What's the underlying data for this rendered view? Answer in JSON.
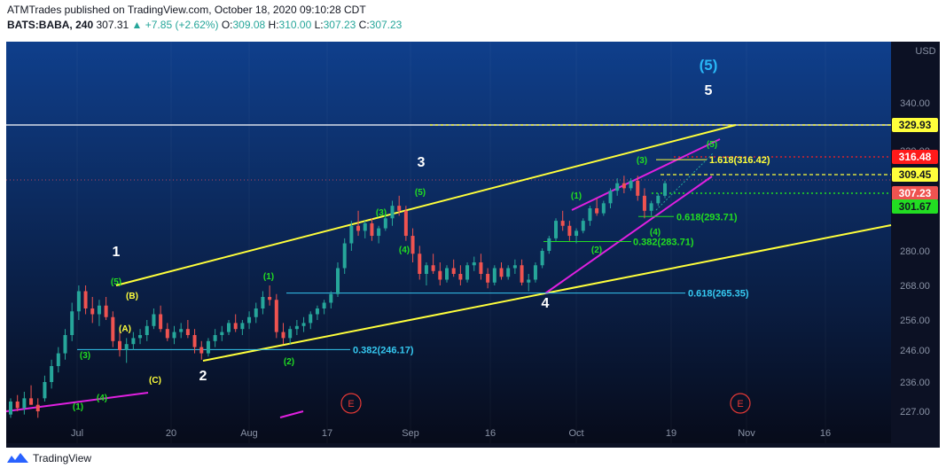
{
  "header": {
    "line1": "ATMTrades published on TradingView.com, October 18, 2020 09:10:28 CDT",
    "symbol": "BATS:BABA, 240",
    "last": "307.31",
    "change_arrow": "▲",
    "change": "+7.85 (+2.62%)",
    "o_label": "O:",
    "o_value": "309.08",
    "h_label": "H:",
    "h_value": "310.00",
    "l_label": "L:",
    "l_value": "307.23",
    "c_label": "C:",
    "c_value": "307.23"
  },
  "footer": {
    "brand": "TradingView"
  },
  "colors": {
    "bg_top": "#0f3f8c",
    "bg_bottom": "#070b1a",
    "up": "#26a69a",
    "down": "#ef5350",
    "channel": "#ffff3b",
    "magenta": "#e020e0",
    "fib_cyan": "#35c8f0",
    "green": "#22dd22",
    "white": "#ffffff"
  },
  "chart_data": {
    "type": "candlestick",
    "currency": "USD",
    "x_ticks": [
      "Jul",
      "20",
      "Aug",
      "17",
      "Sep",
      "16",
      "Oct",
      "19",
      "Nov",
      "16"
    ],
    "y_ticks": [
      227.0,
      236.0,
      246.0,
      256.0,
      268.0,
      280.0,
      320.0,
      340.0
    ],
    "ylim": [
      224,
      362
    ],
    "price_badges": [
      {
        "value": "329.93",
        "bg": "#ffff3b",
        "fg": "#131722"
      },
      {
        "value": "316.48",
        "bg": "#ff1a1a",
        "fg": "#ffffff"
      },
      {
        "value": "309.45",
        "bg": "#ffff3b",
        "fg": "#131722"
      },
      {
        "value": "307.23",
        "bg": "#ef5350",
        "fg": "#ffffff"
      },
      {
        "value": "301.67",
        "bg": "#22dd22",
        "fg": "#131722"
      }
    ],
    "fib_levels": [
      {
        "text": "0.382(246.17)",
        "price": 246.17,
        "color": "#35c8f0"
      },
      {
        "text": "0.618(265.35)",
        "price": 265.35,
        "color": "#35c8f0"
      },
      {
        "text": "0.382(283.71)",
        "price": 283.71,
        "color": "#22dd22"
      },
      {
        "text": "0.618(293.71)",
        "price": 293.71,
        "color": "#22dd22"
      },
      {
        "text": "1.618(316.42)",
        "price": 316.42,
        "color": "#ffff3b"
      }
    ],
    "wave_labels_primary": [
      "1",
      "2",
      "3",
      "4",
      "5",
      "(5)"
    ],
    "wave_labels_minor_green": [
      "(1)",
      "(2)",
      "(3)",
      "(4)",
      "(5)"
    ],
    "wave_labels_abc": [
      "(A)",
      "(B)",
      "(C)"
    ],
    "event_markers": [
      "E",
      "E"
    ],
    "candles": [
      [
        226,
        231,
        225,
        230
      ],
      [
        230,
        232,
        227,
        228
      ],
      [
        228,
        233,
        226,
        231
      ],
      [
        231,
        235,
        229,
        229
      ],
      [
        229,
        231,
        225,
        227
      ],
      [
        231,
        238,
        230,
        236
      ],
      [
        236,
        243,
        234,
        241
      ],
      [
        241,
        247,
        239,
        245
      ],
      [
        245,
        253,
        243,
        251
      ],
      [
        251,
        262,
        249,
        259
      ],
      [
        259,
        268,
        256,
        266
      ],
      [
        266,
        268,
        258,
        260
      ],
      [
        260,
        264,
        255,
        258
      ],
      [
        258,
        263,
        254,
        261
      ],
      [
        261,
        264,
        256,
        257
      ],
      [
        257,
        259,
        247,
        249
      ],
      [
        249,
        253,
        244,
        246
      ],
      [
        246,
        250,
        242,
        248
      ],
      [
        248,
        252,
        246,
        250
      ],
      [
        250,
        253,
        248,
        251
      ],
      [
        251,
        256,
        249,
        254
      ],
      [
        254,
        260,
        253,
        258
      ],
      [
        258,
        261,
        252,
        253
      ],
      [
        253,
        255,
        249,
        250
      ],
      [
        250,
        254,
        248,
        252
      ],
      [
        252,
        255,
        250,
        253
      ],
      [
        253,
        256,
        250,
        251
      ],
      [
        251,
        253,
        245,
        247
      ],
      [
        247,
        249,
        243,
        245
      ],
      [
        245,
        250,
        244,
        249
      ],
      [
        249,
        253,
        247,
        251
      ],
      [
        251,
        254,
        249,
        252
      ],
      [
        252,
        256,
        251,
        255
      ],
      [
        255,
        258,
        252,
        253
      ],
      [
        253,
        256,
        251,
        255
      ],
      [
        255,
        259,
        253,
        257
      ],
      [
        257,
        262,
        255,
        260
      ],
      [
        260,
        266,
        258,
        264
      ],
      [
        264,
        268,
        261,
        263
      ],
      [
        263,
        265,
        250,
        252
      ],
      [
        252,
        255,
        248,
        250
      ],
      [
        250,
        254,
        248,
        253
      ],
      [
        253,
        256,
        251,
        254
      ],
      [
        254,
        257,
        252,
        255
      ],
      [
        255,
        259,
        253,
        258
      ],
      [
        258,
        261,
        256,
        260
      ],
      [
        260,
        263,
        258,
        262
      ],
      [
        262,
        266,
        260,
        265
      ],
      [
        265,
        276,
        264,
        274
      ],
      [
        274,
        285,
        272,
        283
      ],
      [
        283,
        292,
        280,
        290
      ],
      [
        290,
        296,
        286,
        288
      ],
      [
        288,
        292,
        285,
        291
      ],
      [
        291,
        293,
        284,
        286
      ],
      [
        286,
        290,
        283,
        289
      ],
      [
        289,
        295,
        288,
        293
      ],
      [
        293,
        300,
        290,
        298
      ],
      [
        298,
        302,
        294,
        296
      ],
      [
        296,
        298,
        284,
        286
      ],
      [
        286,
        289,
        276,
        279
      ],
      [
        279,
        282,
        270,
        272
      ],
      [
        272,
        276,
        268,
        275
      ],
      [
        275,
        279,
        272,
        273
      ],
      [
        273,
        276,
        268,
        270
      ],
      [
        270,
        275,
        269,
        274
      ],
      [
        274,
        277,
        271,
        272
      ],
      [
        272,
        275,
        268,
        270
      ],
      [
        270,
        276,
        269,
        275
      ],
      [
        275,
        278,
        273,
        276
      ],
      [
        276,
        279,
        270,
        272
      ],
      [
        272,
        274,
        267,
        269
      ],
      [
        269,
        275,
        268,
        274
      ],
      [
        274,
        276,
        270,
        271
      ],
      [
        271,
        275,
        270,
        274
      ],
      [
        274,
        277,
        272,
        275
      ],
      [
        275,
        277,
        268,
        269
      ],
      [
        269,
        272,
        266,
        270
      ],
      [
        270,
        276,
        269,
        275
      ],
      [
        275,
        281,
        274,
        280
      ],
      [
        280,
        286,
        279,
        285
      ],
      [
        285,
        293,
        284,
        292
      ],
      [
        292,
        296,
        288,
        290
      ],
      [
        290,
        292,
        284,
        286
      ],
      [
        286,
        289,
        283,
        288
      ],
      [
        288,
        293,
        287,
        292
      ],
      [
        292,
        298,
        290,
        297
      ],
      [
        297,
        301,
        294,
        295
      ],
      [
        295,
        300,
        294,
        299
      ],
      [
        299,
        305,
        297,
        304
      ],
      [
        304,
        309,
        302,
        307
      ],
      [
        307,
        310,
        303,
        305
      ],
      [
        305,
        309,
        304,
        308
      ],
      [
        308,
        310,
        300,
        302
      ],
      [
        302,
        305,
        293,
        296
      ],
      [
        296,
        300,
        294,
        299
      ],
      [
        299,
        303,
        298,
        302
      ],
      [
        302,
        308,
        301,
        307
      ]
    ]
  }
}
